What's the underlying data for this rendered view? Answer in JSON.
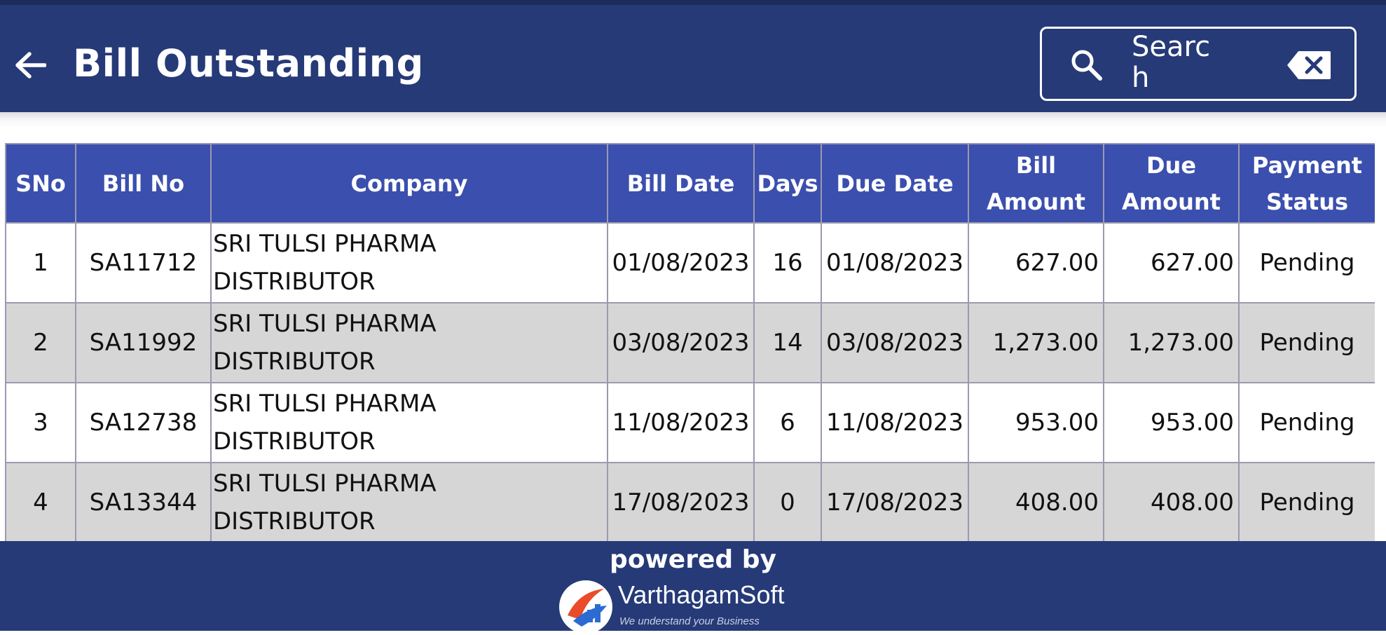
{
  "header": {
    "title": "Bill Outstanding",
    "back_icon": "arrow-left-icon",
    "search_placeholder": "Search",
    "search_icon": "search-icon",
    "clear_icon": "backspace-clear-icon"
  },
  "table": {
    "columns": [
      "SNo",
      "Bill No",
      "Company",
      "Bill Date",
      "Days",
      "Due Date",
      "Bill Amount",
      "Due Amount",
      "Payment Status"
    ],
    "rows": [
      {
        "sno": "1",
        "bill_no": "SA11712",
        "company": "SRI TULSI PHARMA DISTRIBUTOR",
        "bill_date": "01/08/2023",
        "days": "16",
        "due_date": "01/08/2023",
        "bill_amount": "627.00",
        "due_amount": "627.00",
        "status": "Pending"
      },
      {
        "sno": "2",
        "bill_no": "SA11992",
        "company": "SRI TULSI PHARMA DISTRIBUTOR",
        "bill_date": "03/08/2023",
        "days": "14",
        "due_date": "03/08/2023",
        "bill_amount": "1,273.00",
        "due_amount": "1,273.00",
        "status": "Pending"
      },
      {
        "sno": "3",
        "bill_no": "SA12738",
        "company": "SRI TULSI PHARMA DISTRIBUTOR",
        "bill_date": "11/08/2023",
        "days": "6",
        "due_date": "11/08/2023",
        "bill_amount": "953.00",
        "due_amount": "953.00",
        "status": "Pending"
      },
      {
        "sno": "4",
        "bill_no": "SA13344",
        "company": "SRI TULSI PHARMA DISTRIBUTOR",
        "bill_date": "17/08/2023",
        "days": "0",
        "due_date": "17/08/2023",
        "bill_amount": "408.00",
        "due_amount": "408.00",
        "status": "Pending"
      }
    ]
  },
  "footer": {
    "powered_by": "powered by",
    "brand_name": "VarthagamSoft",
    "brand_tagline": "We understand your Business",
    "logo_icon": "varthagamsoft-logo-icon"
  },
  "colors": {
    "appbar": "#263a78",
    "table_header": "#3b4fae",
    "row_alt": "#d6d6d6"
  }
}
